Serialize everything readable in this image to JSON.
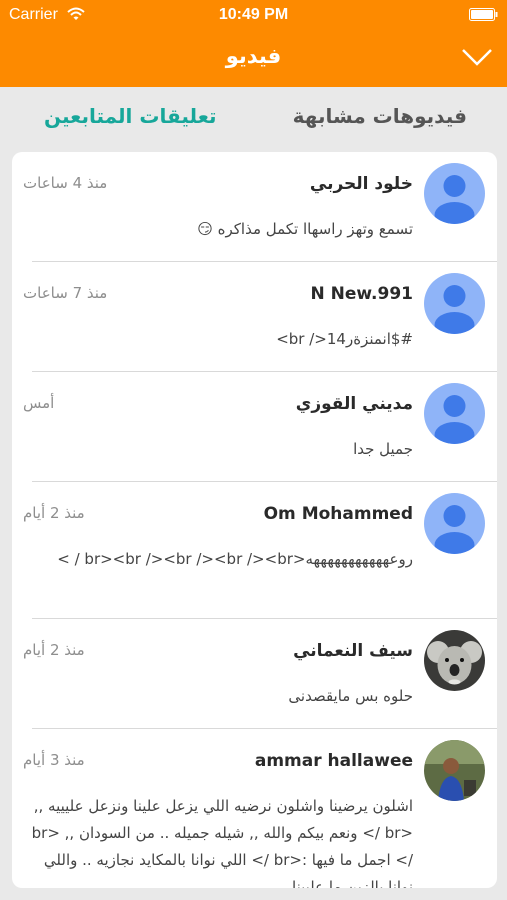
{
  "status_bar": {
    "carrier": "Carrier",
    "time": "10:49 PM"
  },
  "nav": {
    "title": "فيديو"
  },
  "tabs": {
    "similar_videos": "فيديوهات مشابهة",
    "follower_comments": "تعليقات المتابعين"
  },
  "comments": [
    {
      "name": "خلود الحربي",
      "time": "منذ 4 ساعات",
      "text": "تسمع وتهز راسهاا تكمل مذاكره 😏",
      "avatar": "default-avatar"
    },
    {
      "name": "N New.991",
      "time": "منذ 7 ساعات",
      "text": "#$انمنزةر14</ br>",
      "avatar": "default-avatar"
    },
    {
      "name": "مديني القوزي",
      "time": "أمس",
      "text": "جميل جدا",
      "avatar": "default-avatar"
    },
    {
      "name": "Om Mohammed",
      "time": "منذ 2 أيام",
      "text": "روعهههههههههههه<br><br /><br /><br /><br / >",
      "avatar": "default-avatar"
    },
    {
      "name": "سيف النعماني",
      "time": "منذ 2 أيام",
      "text": "حلوه بس مايقصدنى",
      "avatar": "koala-photo"
    },
    {
      "name": "ammar hallawee",
      "time": "منذ 3 أيام",
      "text": "اشلون يرضينا واشلون نرضيه اللي يزعل علينا ونزعل عليييه ,, <br /> ونعم بيكم والله ,, شيله جميله .. من السودان ,, <br /> اجمل ما فيها :<br /> اللي نوانا بالمكايد نجازيه .. واللي نوانا بالزين ما عليينا",
      "avatar": "person-photo"
    }
  ],
  "colors": {
    "header": "#fd8a00",
    "accent_tab": "#17a79a",
    "avatar_bg": "#8fb4f8",
    "avatar_fg": "#3f7ae8"
  }
}
